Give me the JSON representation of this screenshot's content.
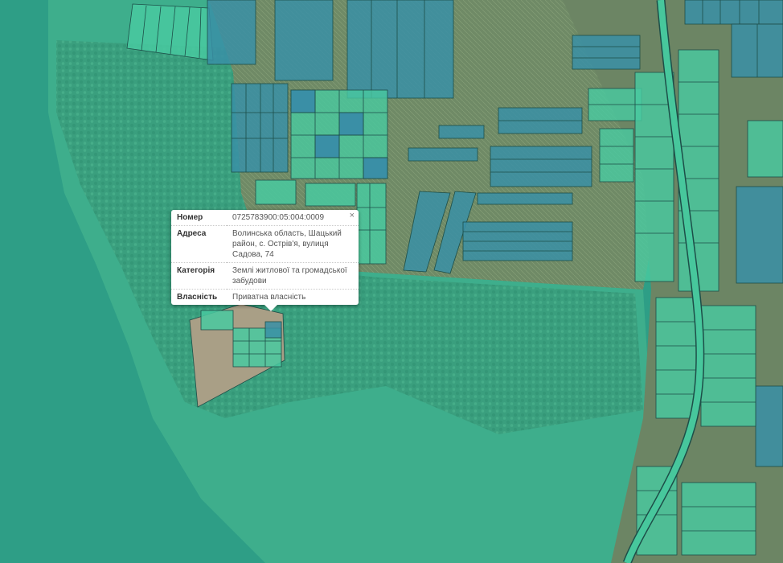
{
  "map": {
    "layer": "cadastral-parcels",
    "colors": {
      "water": "#2e9e86",
      "marsh": "#3fb08d",
      "forest": "#3a9f7e",
      "fields": "#6f8a66",
      "parcel_residential": "#49c9a0",
      "parcel_agricultural": "#3a8fa6",
      "road": "#47c79c",
      "parcel_border": "#1d4e48"
    }
  },
  "popup": {
    "close": "×",
    "rows": [
      {
        "key": "Номер",
        "value": "0725783900:05:004:0009"
      },
      {
        "key": "Адреса",
        "value": "Волинська область, Шацький район, с. Острів'я, вулиця Садова, 74"
      },
      {
        "key": "Категорія",
        "value": "Землі житлової та громадської забудови"
      },
      {
        "key": "Власність",
        "value": "Приватна власність"
      }
    ]
  }
}
